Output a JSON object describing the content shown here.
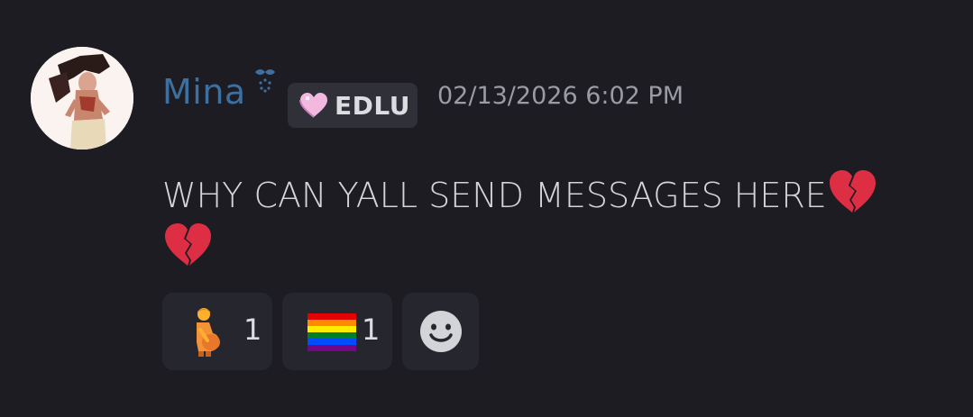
{
  "message": {
    "username": "Mina",
    "tag": {
      "label": "EDLU",
      "icon": "pink-heart-icon"
    },
    "timestamp": "02/13/2026 6:02 PM",
    "content": "WHY CAN YALL SEND MESSAGES HERE",
    "content_emoji": [
      "broken-heart-icon",
      "broken-heart-icon"
    ]
  },
  "reactions": [
    {
      "emoji": "pregnant-person-icon",
      "count": "1"
    },
    {
      "emoji": "rainbow-flag-icon",
      "count": "1"
    },
    {
      "emoji": "add-reaction-icon"
    }
  ],
  "colors": {
    "background": "#1c1c22",
    "username": "#3d6f9f",
    "timestamp": "#9a9ba3",
    "tag_background": "#2f3038",
    "reaction_background": "#26272e"
  }
}
